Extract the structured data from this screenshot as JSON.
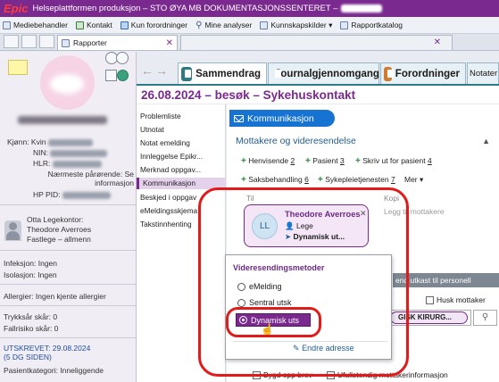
{
  "titlebar": {
    "logo": "Epic",
    "title": "Helseplattformen produksjon – STO ØYA MB DOKUMENTASJONSSENTERET –"
  },
  "menubar": {
    "items": [
      {
        "label": "Mediebehandler",
        "icon": "media-icon"
      },
      {
        "label": "Kontakt",
        "icon": "plus-icon"
      },
      {
        "label": "Kun forordninger",
        "icon": "book-icon"
      },
      {
        "label": "Mine analyser",
        "icon": "search-icon"
      },
      {
        "label": "Kunnskapskilder ▾",
        "icon": "knowledge-icon"
      },
      {
        "label": "Rapportkatalog",
        "icon": "report-icon"
      }
    ]
  },
  "tabs": {
    "rapporter": "Rapporter"
  },
  "patient": {
    "kjonn_label": "Kjønn: Kvin",
    "nin_label": "NIN:",
    "hlr_label": "HLR:",
    "parorende_label": "Nærmeste pårørende: Se informasjon",
    "hp_pid_label": "HP PID:",
    "gp_office": "Otta Legekontor:",
    "gp_name": "Theodore Averroes",
    "gp_role": "Fastlege – allmenn",
    "infeksjon": "Infeksjon: Ingen",
    "isolasjon": "Isolasjon: Ingen",
    "allergier": "Allergier: Ingen kjente allergier",
    "trykksar": "Trykksår skår: 0",
    "fallrisiko": "Fallrisiko skår: 0",
    "utskrevet": "UTSKREVET: 29.08.2024",
    "utskrevet_days": "(5  DG SIDEN)",
    "pasientkategori": "Pasientkategori: Inneliggende"
  },
  "activity_tabs": [
    {
      "label": "Sammendrag"
    },
    {
      "label": "Journalgjennomgang"
    },
    {
      "label": "Forordninger"
    },
    {
      "label": "Notater"
    }
  ],
  "visit": {
    "header": "26.08.2024 – besøk – Sykehuskontakt"
  },
  "left_menu": [
    "Problemliste",
    "Utnotat",
    "Notat emelding",
    "Innleggelse Epikr...",
    "Merknad oppgav...",
    "Kommunikasjon",
    "Beskjed i oppgav",
    "eMeldingsskjema",
    "Takstinnhenting"
  ],
  "communication": {
    "section_title": "Kommunikasjon",
    "sub_title": "Mottakere og videresendelse",
    "actions": [
      {
        "label": "Henvisende",
        "num": "2"
      },
      {
        "label": "Pasient",
        "num": "3"
      },
      {
        "label": "Skriv ut for pasient",
        "num": "4"
      },
      {
        "label": "Saksbehandling",
        "num": "6"
      },
      {
        "label": "Sykepleietjenesten",
        "num": "7"
      },
      {
        "label": "Mer ▾",
        "num": ""
      }
    ],
    "to_label": "Til",
    "cc_label": "Kopi",
    "cc_placeholder": "Legg til mottakere",
    "recipient": {
      "initials": "LL",
      "name": "Theodore Averroes",
      "role": "Lege",
      "method": "Dynamisk ut..."
    },
    "gray_button": "end utkast til personell",
    "husk_mottaker": "Husk mottaker",
    "right_chip": "GISK KIRURG...",
    "bottom_check_1": "Bygd opp brev",
    "bottom_check_2": "Ufullstendig mottakerinformasjon"
  },
  "popup": {
    "title": "Videresendingsmetoder",
    "options": [
      {
        "label": "eMelding",
        "selected": false
      },
      {
        "label": "Sentral utsk",
        "selected": false
      },
      {
        "label": "Dynamisk uts",
        "selected": true
      }
    ],
    "change_address": "Endre adresse"
  },
  "colors": {
    "brand_purple": "#7a2a8e",
    "accent_blue": "#1673d1",
    "annotation_red": "#e11a1a"
  }
}
